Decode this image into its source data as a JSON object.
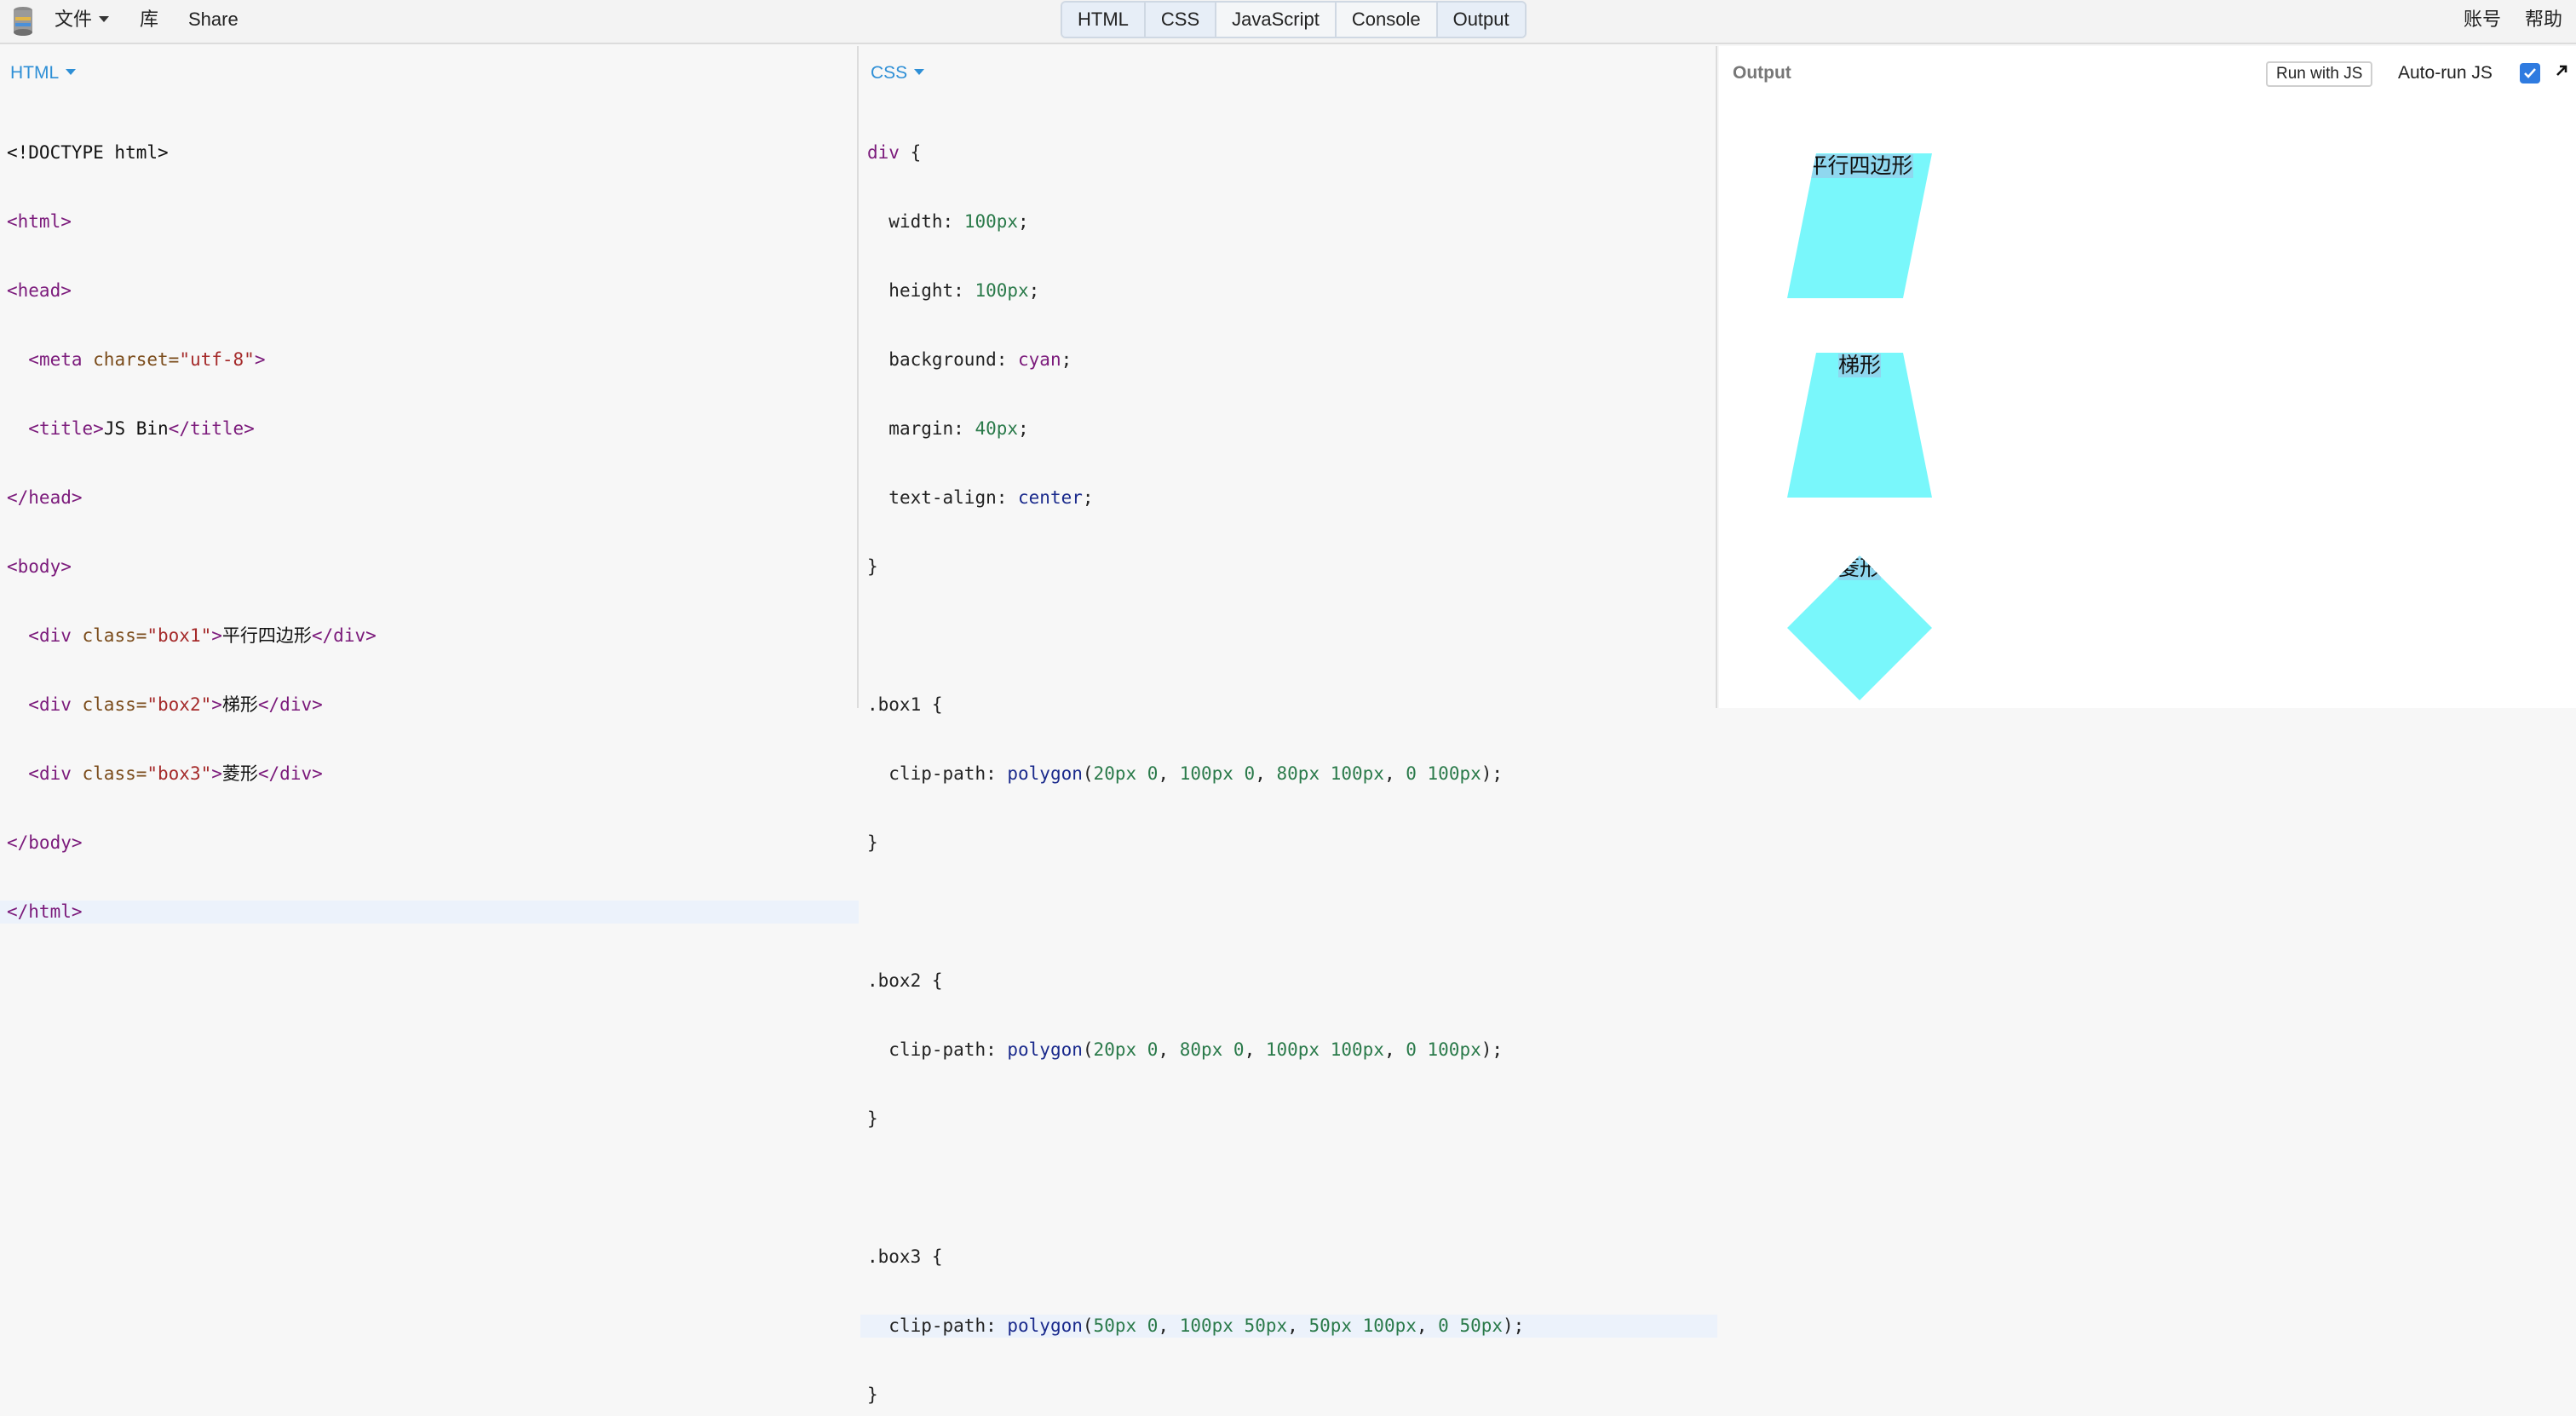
{
  "topbar": {
    "menu_file": "文件",
    "menu_library": "库",
    "menu_share": "Share",
    "tabs": [
      "HTML",
      "CSS",
      "JavaScript",
      "Console",
      "Output"
    ],
    "account": "账号",
    "help": "帮助"
  },
  "html_panel": {
    "label": "HTML",
    "lines": {
      "l1": "<!DOCTYPE html>",
      "l2": "<html>",
      "l3": "<head>",
      "l4_tag": "<meta ",
      "l4_attr": "charset=",
      "l4_str": "\"utf-8\"",
      "l4_end": ">",
      "l5_open": "<title>",
      "l5_text": "JS Bin",
      "l5_close": "</title>",
      "l6": "</head>",
      "l7": "<body>",
      "l8_open": "<div ",
      "l8_attr": "class=",
      "l8_str": "\"box1\"",
      "l8_gt": ">",
      "l8_text": "平行四边形",
      "l8_close": "</div>",
      "l9_open": "<div ",
      "l9_attr": "class=",
      "l9_str": "\"box2\"",
      "l9_gt": ">",
      "l9_text": "梯形",
      "l9_close": "</div>",
      "l10_open": "<div ",
      "l10_attr": "class=",
      "l10_str": "\"box3\"",
      "l10_gt": ">",
      "l10_text": "菱形",
      "l10_close": "</div>",
      "l11": "</body>",
      "l12": "</html>"
    }
  },
  "css_panel": {
    "label": "CSS",
    "lines": {
      "c1_sel": "div",
      "c1_brace": " {",
      "c2_prop": "width: ",
      "c2_val": "100px",
      "c3_prop": "height: ",
      "c3_val": "100px",
      "c4_prop": "background: ",
      "c4_val": "cyan",
      "c5_prop": "margin: ",
      "c5_val": "40px",
      "c6_prop": "text-align: ",
      "c6_val": "center",
      "semi": ";",
      "close": "}",
      "c8_sel": ".box1 {",
      "c9_prop": "clip-path: ",
      "c9_fn": "polygon",
      "c9_args_a": "(",
      "c9_n1": "20px 0",
      "c9_n2": "100px 0",
      "c9_n3": "80px 100px",
      "c9_n4": "0 100px",
      "c12_sel": ".box2 {",
      "c13_n1": "20px 0",
      "c13_n2": "80px 0",
      "c13_n3": "100px 100px",
      "c13_n4": "0 100px",
      "c16_sel": ".box3 {",
      "c17_n1": "50px 0",
      "c17_n2": "100px 50px",
      "c17_n3": "50px 100px",
      "c17_n4": "0 50px",
      "comma": ", ",
      "paren_close": ");"
    }
  },
  "output_panel": {
    "label": "Output",
    "run_button": "Run with JS",
    "autorun_label": "Auto-run JS",
    "autorun_checked": true,
    "shapes": {
      "box1_text": "平行四边形",
      "box2_text": "梯形",
      "box3_text": "菱形"
    }
  },
  "colors": {
    "accent": "#2e8fd6",
    "shape_fill": "#79f7fb",
    "checkbox": "#2f7be0"
  }
}
